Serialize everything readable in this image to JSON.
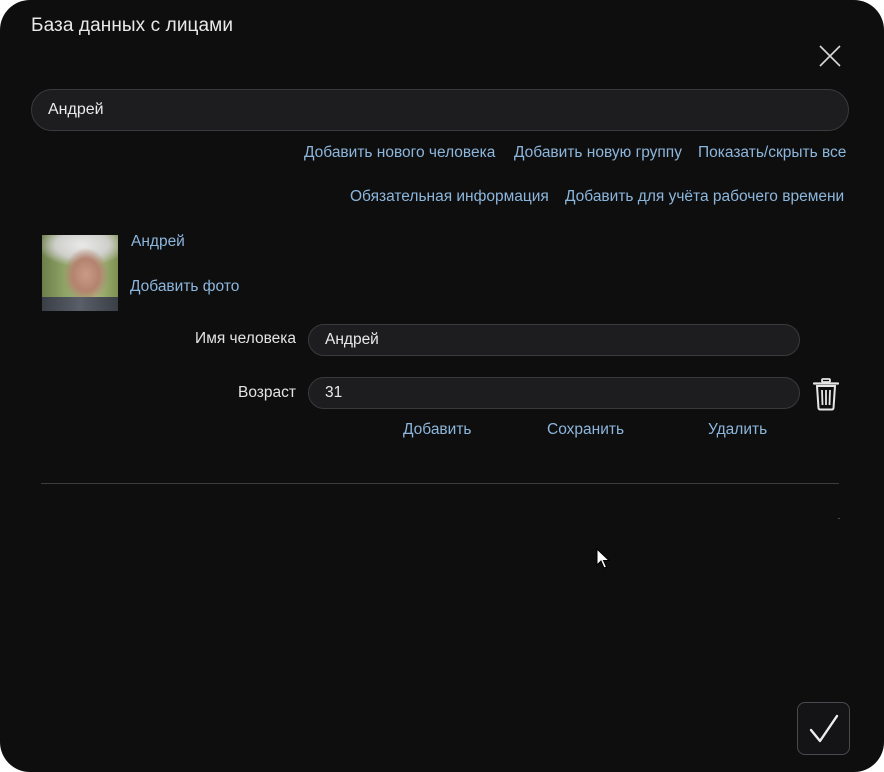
{
  "dialog": {
    "title": "База данных с лицами",
    "close_icon": "close-icon",
    "confirm_icon": "check-icon"
  },
  "search": {
    "value": "Андрей"
  },
  "actions": {
    "add_person": "Добавить нового человека",
    "add_group": "Добавить новую группу",
    "toggle_all": "Показать/скрыть все",
    "required_info": "Обязательная информация",
    "add_worktime": "Добавить для учёта рабочего времени"
  },
  "person": {
    "name_link": "Андрей",
    "add_photo": "Добавить фото",
    "photo_icon": "person-photo",
    "fields": {
      "name_label": "Имя человека",
      "name_value": "Андрей",
      "age_label": "Возраст",
      "age_value": "31"
    },
    "buttons": {
      "add": "Добавить",
      "save": "Сохранить",
      "delete": "Удалить"
    },
    "delete_icon": "trash-icon"
  },
  "colors": {
    "background": "#0e0e0f",
    "link": "#8db6dc",
    "field_bg": "#1d1d1f"
  }
}
